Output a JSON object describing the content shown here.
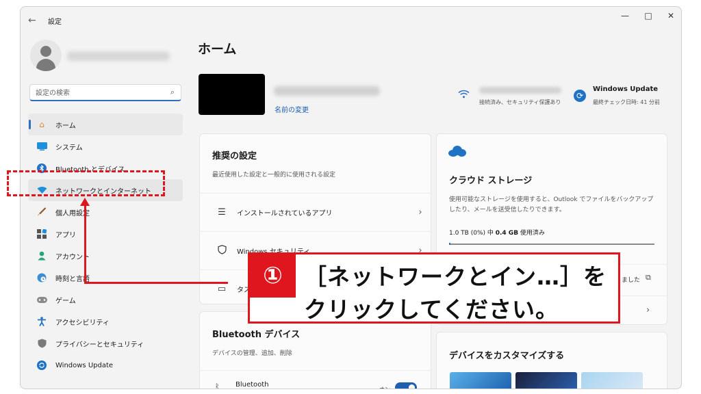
{
  "window": {
    "title": "設定",
    "back": "←",
    "minimize": "—",
    "maximize": "□",
    "close": "✕"
  },
  "sidebar": {
    "search_placeholder": "設定の検索",
    "items": [
      {
        "label": "ホーム",
        "icon": "home-icon"
      },
      {
        "label": "システム",
        "icon": "monitor-icon"
      },
      {
        "label": "Bluetooth とデバイス",
        "icon": "bluetooth-icon"
      },
      {
        "label": "ネットワークとインターネット",
        "icon": "wifi-icon"
      },
      {
        "label": "個人用設定",
        "icon": "brush-icon"
      },
      {
        "label": "アプリ",
        "icon": "apps-icon"
      },
      {
        "label": "アカウント",
        "icon": "person-icon"
      },
      {
        "label": "時刻と言語",
        "icon": "globe-clock-icon"
      },
      {
        "label": "ゲーム",
        "icon": "gamepad-icon"
      },
      {
        "label": "アクセシビリティ",
        "icon": "accessibility-icon"
      },
      {
        "label": "プライバシーとセキュリティ",
        "icon": "shield-icon"
      },
      {
        "label": "Windows Update",
        "icon": "update-icon"
      }
    ]
  },
  "main": {
    "title": "ホーム",
    "rename": "名前の変更",
    "network_status": "接続済み、セキュリティ保護あり",
    "update_title": "Windows Update",
    "update_status": "最終チェック日時: 41 分前"
  },
  "recommended": {
    "title": "推奨の設定",
    "subtitle": "最近使用した設定と一般的に使用される設定",
    "rows": [
      {
        "label": "インストールされているアプリ"
      },
      {
        "label": "Windows セキュリティ"
      },
      {
        "label": "タス"
      }
    ]
  },
  "cloud": {
    "title": "クラウド ストレージ",
    "desc_line1": "使用可能なストレージを使用すると、Outlook でファイルをバックアップ",
    "desc_line2": "したり、メールを送受信したりできます。",
    "usage_prefix": "1.0 TB (0%) 中 ",
    "usage_value": "0.4 GB",
    "usage_suffix": " 使用済み",
    "usage_fraction": 0.0004,
    "partial_text": "ました"
  },
  "bluetooth": {
    "title": "Bluetooth デバイス",
    "subtitle": "デバイスの管理、追加、削除",
    "row_label": "Bluetooth",
    "toggle_label": "オン"
  },
  "customize": {
    "title": "デバイスをカスタマイズする"
  },
  "callout": {
    "number": "①",
    "line1": "［ネットワークとイン…］を",
    "line2": "クリックしてください。",
    "color": "#e0161e"
  }
}
